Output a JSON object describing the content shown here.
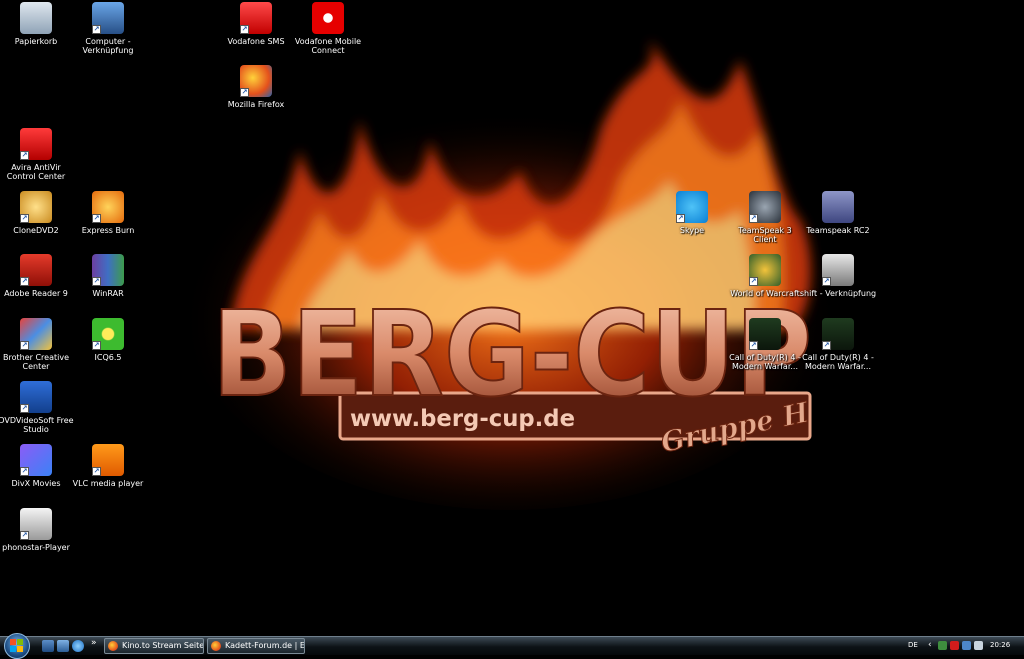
{
  "wallpaper": {
    "logo_text": "BERG-CUP",
    "url_text": "www.berg-cup.de",
    "script_text": "Gruppe H"
  },
  "desktop": {
    "icons": [
      {
        "label": "Papierkorb",
        "icon": "recycle-bin-icon",
        "shortcut": false
      },
      {
        "label": "Computer - Verknüpfung",
        "icon": "computer-icon",
        "shortcut": true
      },
      {
        "label": "Vodafone SMS",
        "icon": "vodafone-sms-icon",
        "shortcut": true
      },
      {
        "label": "Vodafone Mobile Connect",
        "icon": "vodafone-icon",
        "shortcut": false
      },
      {
        "label": "Mozilla Firefox",
        "icon": "firefox-icon",
        "shortcut": true
      },
      {
        "label": "Avira AntiVir Control Center",
        "icon": "avira-icon",
        "shortcut": true
      },
      {
        "label": "CloneDVD2",
        "icon": "clonedvd-icon",
        "shortcut": true
      },
      {
        "label": "Express Burn",
        "icon": "express-burn-icon",
        "shortcut": true
      },
      {
        "label": "Adobe Reader 9",
        "icon": "adobe-reader-icon",
        "shortcut": true
      },
      {
        "label": "WinRAR",
        "icon": "winrar-icon",
        "shortcut": true
      },
      {
        "label": "Brother Creative Center",
        "icon": "brother-icon",
        "shortcut": true
      },
      {
        "label": "ICQ6.5",
        "icon": "icq-icon",
        "shortcut": true
      },
      {
        "label": "DVDVideoSoft Free Studio",
        "icon": "dvdvideosoft-icon",
        "shortcut": true
      },
      {
        "label": "DivX Movies",
        "icon": "divx-icon",
        "shortcut": true
      },
      {
        "label": "VLC media player",
        "icon": "vlc-icon",
        "shortcut": true
      },
      {
        "label": "phonostar-Player",
        "icon": "phonostar-icon",
        "shortcut": true
      },
      {
        "label": "Skype",
        "icon": "skype-icon",
        "shortcut": true
      },
      {
        "label": "TeamSpeak 3 Client",
        "icon": "teamspeak-icon",
        "shortcut": true
      },
      {
        "label": "Teamspeak RC2",
        "icon": "teamspeak-rc2-icon",
        "shortcut": false
      },
      {
        "label": "World of Warcraft",
        "icon": "wow-icon",
        "shortcut": true
      },
      {
        "label": "shift - Verknüpfung",
        "icon": "shift-icon",
        "shortcut": true
      },
      {
        "label": "Call of Duty(R) 4 - Modern Warfar...",
        "icon": "cod4-icon",
        "shortcut": true
      },
      {
        "label": "Call of Duty(R) 4 - Modern Warfar...",
        "icon": "cod4-mp-icon",
        "shortcut": true
      }
    ]
  },
  "taskbar": {
    "tasks": [
      {
        "label": "Kino.to Stream Seite..."
      },
      {
        "label": "Kadett-Forum.de | E..."
      }
    ],
    "language": "DE",
    "clock": "20:26",
    "overflow": "»"
  },
  "colors": {
    "fire_dark": "#7a1400",
    "fire_mid": "#e0420c",
    "fire_light": "#ffb14a",
    "logo": "#e9a78a"
  }
}
